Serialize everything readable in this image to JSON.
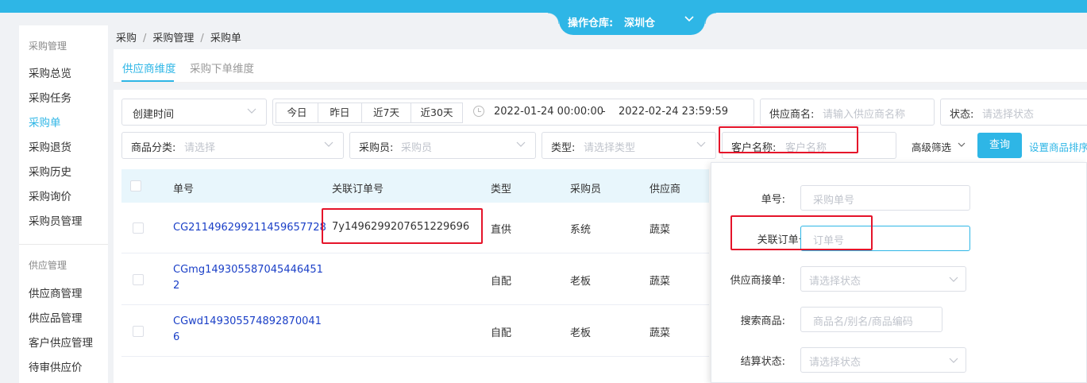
{
  "warehouse": {
    "label": "操作仓库:",
    "value": "深圳仓"
  },
  "sidebar": {
    "group1": "采购管理",
    "items1": [
      "采购总览",
      "采购任务",
      "采购单",
      "采购退货",
      "采购历史",
      "采购询价",
      "采购员管理"
    ],
    "active_item": "采购单",
    "group2": "供应管理",
    "items2": [
      "供应商管理",
      "供应品管理",
      "客户供应管理",
      "待审供应价"
    ]
  },
  "breadcrumb": [
    "采购",
    "采购管理",
    "采购单"
  ],
  "tabs": [
    "供应商维度",
    "采购下单维度"
  ],
  "filters": {
    "time_type": "创建时间",
    "quick_dates": [
      "今日",
      "昨日",
      "近7天",
      "近30天"
    ],
    "date_start": "2022-01-24 00:00:00",
    "date_sep": "-",
    "date_end": "2022-02-24 23:59:59",
    "supplier_name_label": "供应商名:",
    "supplier_name_placeholder": "请输入供应商名称",
    "status_label": "状态:",
    "status_placeholder": "请选择状态",
    "category_label": "商品分类:",
    "category_placeholder": "请选择",
    "buyer_label": "采购员:",
    "buyer_placeholder": "采购员",
    "type_label": "类型:",
    "type_placeholder": "请选择类型",
    "customer_label": "客户名称:",
    "customer_placeholder": "客户名称",
    "advanced_label": "高级筛选",
    "query_button": "查询",
    "settings_link": "设置商品排序"
  },
  "table": {
    "columns": [
      "单号",
      "关联订单号",
      "类型",
      "采购员",
      "供应商"
    ],
    "rows": [
      {
        "order_no": "CG21149629921145965 7728",
        "order_no_display": "CG211496299211459657728",
        "related": "7y1496299207651229696",
        "type": "直供",
        "buyer": "系统",
        "supplier": "蔬菜"
      },
      {
        "order_no_display": "CGmg1493055870454464512",
        "related": "",
        "type": "自配",
        "buyer": "老板",
        "supplier": "蔬菜"
      },
      {
        "order_no_display": "CGwd1493055748928700416",
        "related": "",
        "type": "自配",
        "buyer": "老板",
        "supplier": "蔬菜"
      }
    ],
    "row2_line1": "CGmg149305587045446451",
    "row2_line2": "2",
    "row3_line1": "CGwd149305574892870041",
    "row3_line2": "6"
  },
  "advanced": {
    "order_no_label": "单号:",
    "order_no_placeholder": "采购单号",
    "related_label": "关联订单号:",
    "related_placeholder": "订单号",
    "supplier_accept_label": "供应商接单:",
    "supplier_accept_placeholder": "请选择状态",
    "search_goods_label": "搜索商品:",
    "search_goods_placeholder": "商品名/别名/商品编码",
    "settle_label": "结算状态:",
    "settle_placeholder": "请选择状态"
  },
  "colors": {
    "accent": "#2eb6e6",
    "link": "#1a3fc7",
    "highlight": "#e5142a"
  }
}
